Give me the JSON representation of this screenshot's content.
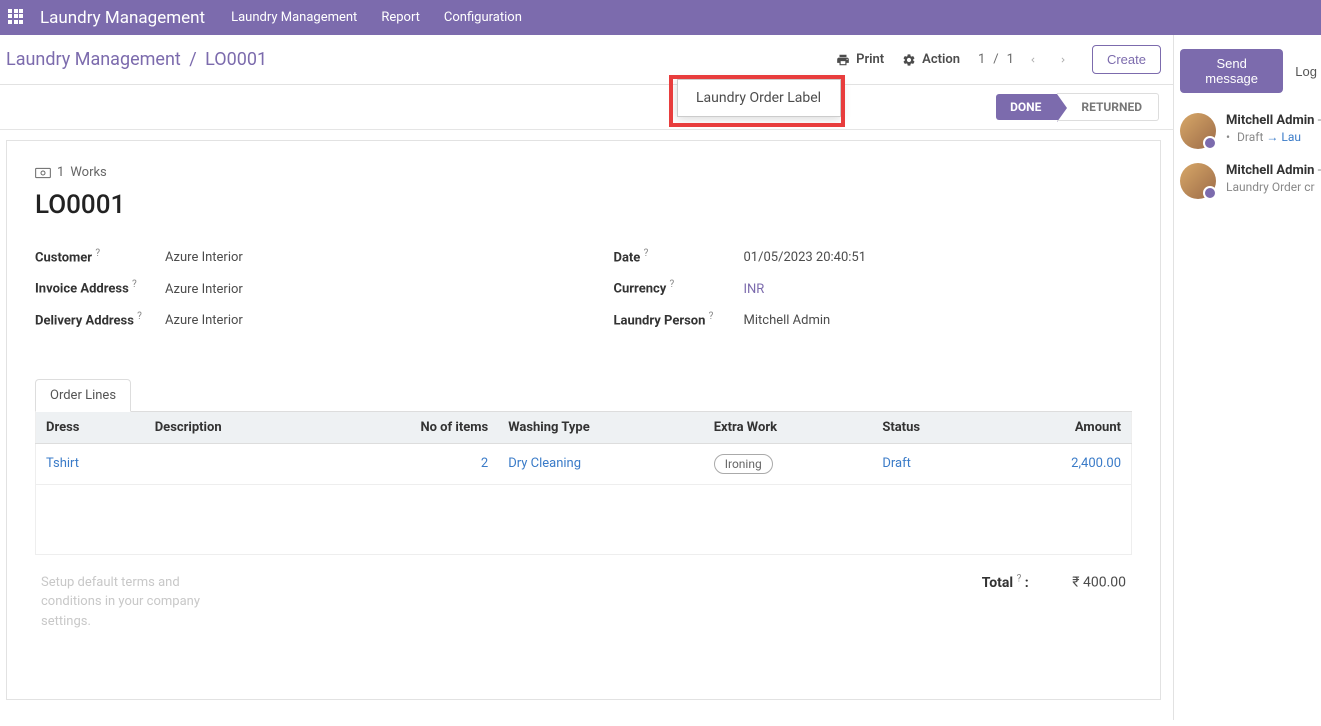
{
  "navbar": {
    "brand": "Laundry Management",
    "items": [
      "Laundry Management",
      "Report",
      "Configuration"
    ]
  },
  "header": {
    "breadcrumb_root": "Laundry Management",
    "breadcrumb_sep": "/",
    "breadcrumb_current": "LO0001",
    "print_label": "Print",
    "action_label": "Action",
    "pager_current": "1",
    "pager_sep": "/",
    "pager_total": "1",
    "create_label": "Create",
    "dropdown_item": "Laundry Order Label"
  },
  "status": {
    "done": "DONE",
    "returned": "RETURNED"
  },
  "sheet": {
    "works_count": "1",
    "works_label": "Works",
    "title": "LO0001",
    "left": {
      "customer_label": "Customer",
      "customer_value": "Azure Interior",
      "invoice_label": "Invoice Address",
      "invoice_value": "Azure Interior",
      "delivery_label": "Delivery Address",
      "delivery_value": "Azure Interior"
    },
    "right": {
      "date_label": "Date",
      "date_value": "01/05/2023 20:40:51",
      "currency_label": "Currency",
      "currency_value": "INR",
      "person_label": "Laundry Person",
      "person_value": "Mitchell Admin"
    },
    "tab_label": "Order Lines",
    "columns": {
      "dress": "Dress",
      "description": "Description",
      "qty": "No of items",
      "washing": "Washing Type",
      "extra": "Extra Work",
      "status": "Status",
      "amount": "Amount"
    },
    "rows": [
      {
        "dress": "Tshirt",
        "description": "",
        "qty": "2",
        "washing": "Dry Cleaning",
        "extra": "Ironing",
        "status": "Draft",
        "amount": "2,400.00"
      }
    ],
    "terms": "Setup default terms and conditions in your company settings.",
    "total_label": "Total",
    "total_value": "₹ 400.00",
    "help": "?"
  },
  "chatter": {
    "send_label": "Send message",
    "log_label": "Log",
    "messages": [
      {
        "author": "Mitchell Admin",
        "dash": " - ",
        "prefix_bullet": "•",
        "sub_before": "Draft",
        "arrow": "→",
        "sub_link": "Lau"
      },
      {
        "author": "Mitchell Admin",
        "dash": " - ",
        "sub_text": "Laundry Order cr"
      }
    ]
  }
}
